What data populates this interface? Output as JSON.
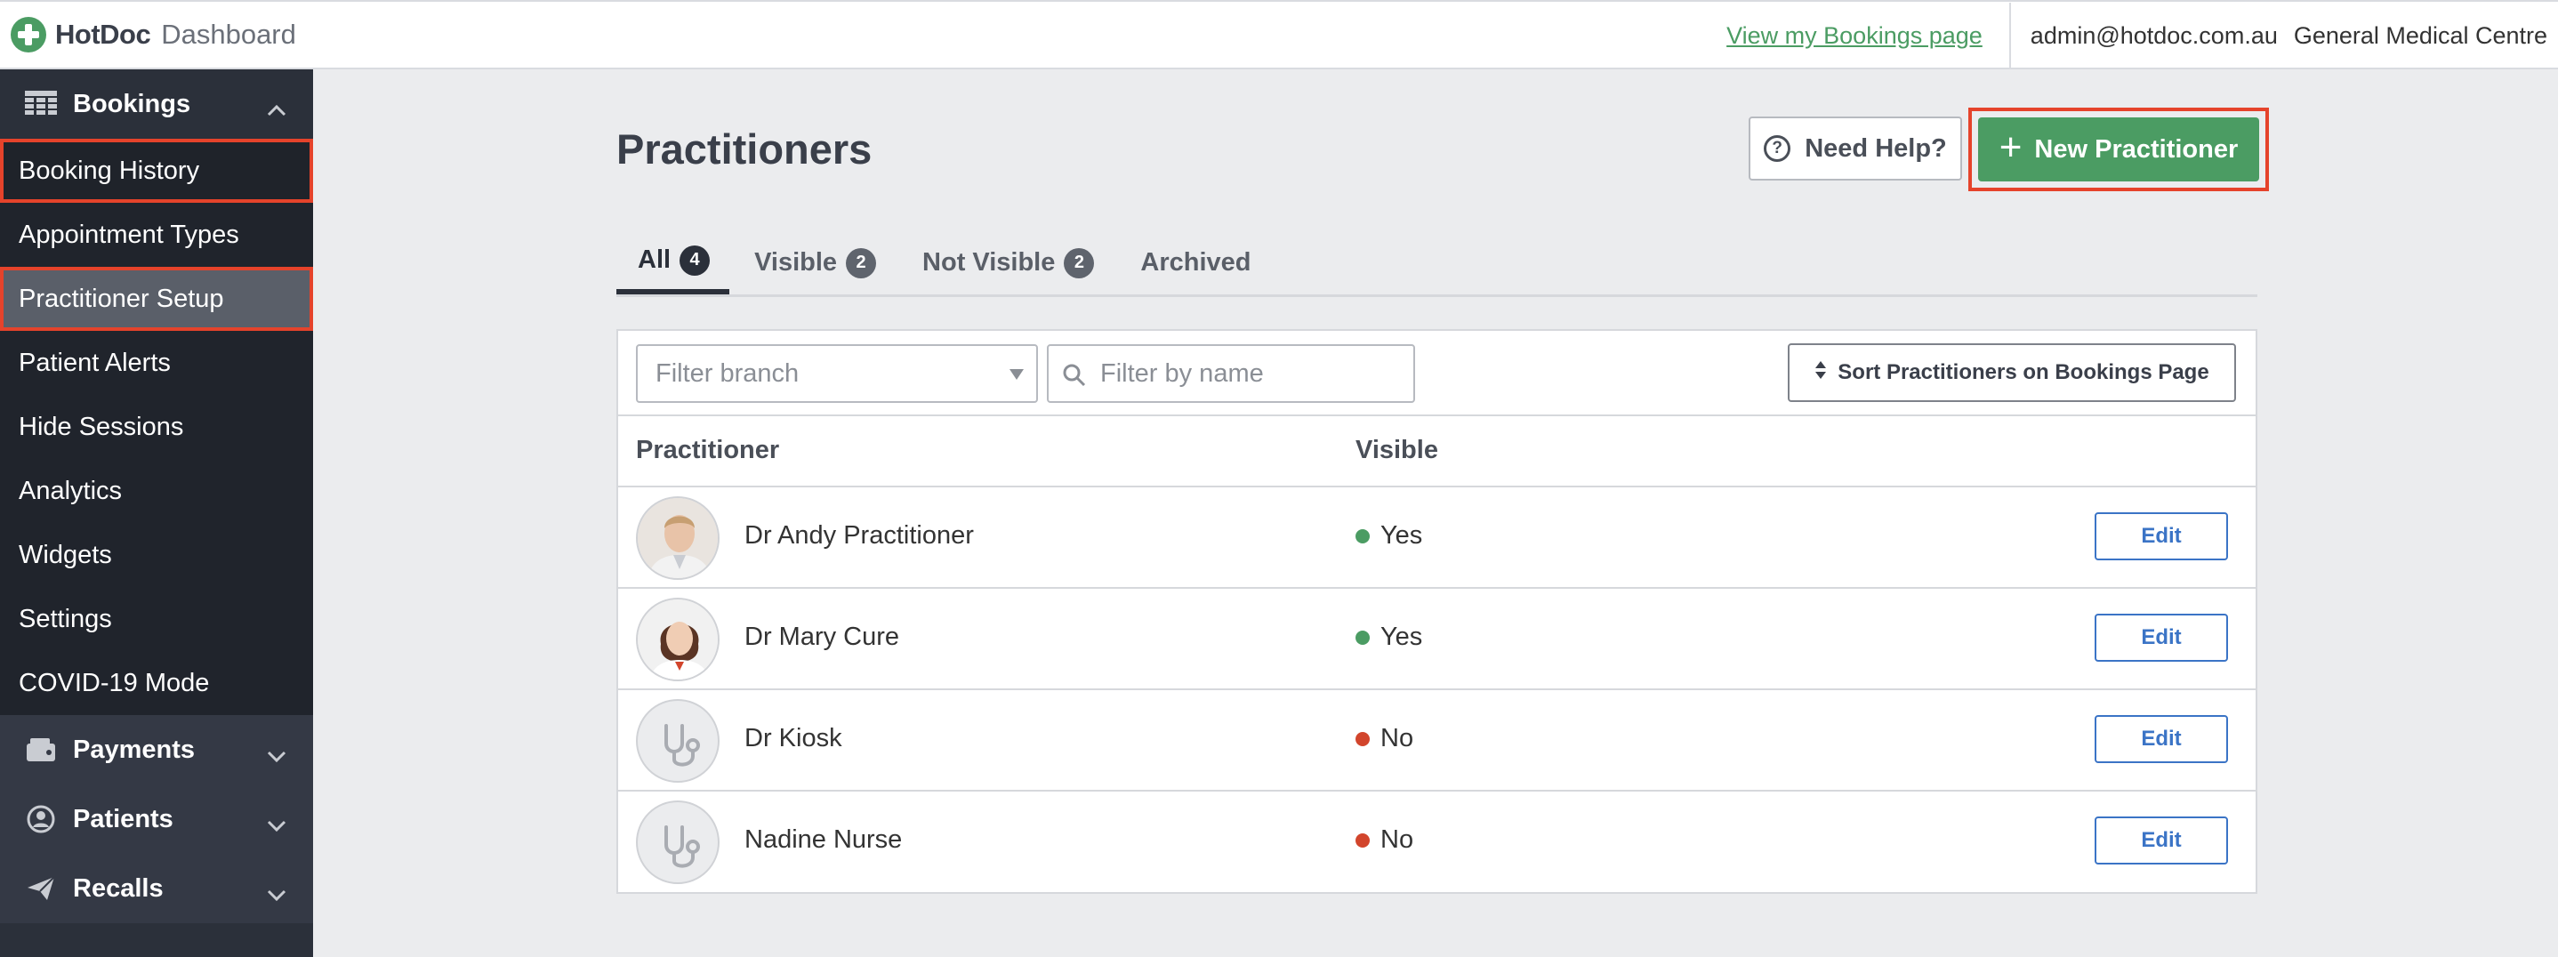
{
  "header": {
    "brand_name": "HotDoc",
    "brand_sub": "Dashboard",
    "view_bookings_link": "View my Bookings page",
    "user_email": "admin@hotdoc.com.au",
    "clinic_name": "General Medical Centre"
  },
  "sidebar": {
    "bookings": {
      "label": "Bookings",
      "icon": "table-grid-icon",
      "expanded": true,
      "items": [
        {
          "label": "Booking History",
          "highlighted": true
        },
        {
          "label": "Appointment Types"
        },
        {
          "label": "Practitioner Setup",
          "active": true,
          "highlighted": true
        },
        {
          "label": "Patient Alerts"
        },
        {
          "label": "Hide Sessions"
        },
        {
          "label": "Analytics"
        },
        {
          "label": "Widgets"
        },
        {
          "label": "Settings"
        },
        {
          "label": "COVID-19 Mode"
        }
      ]
    },
    "payments": {
      "label": "Payments",
      "icon": "wallet-icon"
    },
    "patients": {
      "label": "Patients",
      "icon": "user-circle-icon"
    },
    "recalls": {
      "label": "Recalls",
      "icon": "paper-plane-icon"
    }
  },
  "main": {
    "title": "Practitioners",
    "help_button": "Need Help?",
    "new_button": "New Practitioner",
    "tabs": [
      {
        "label": "All",
        "count": "4",
        "active": true
      },
      {
        "label": "Visible",
        "count": "2"
      },
      {
        "label": "Not Visible",
        "count": "2"
      },
      {
        "label": "Archived"
      }
    ],
    "filters": {
      "branch_placeholder": "Filter branch",
      "name_placeholder": "Filter by name",
      "sort_button": "Sort Practitioners on Bookings Page"
    },
    "table": {
      "columns": [
        "Practitioner",
        "Visible"
      ],
      "rows": [
        {
          "name": "Dr Andy Practitioner",
          "visible": "Yes",
          "avatar": "male-photo",
          "edit": "Edit"
        },
        {
          "name": "Dr Mary Cure",
          "visible": "Yes",
          "avatar": "female-photo",
          "edit": "Edit"
        },
        {
          "name": "Dr Kiosk",
          "visible": "No",
          "avatar": "stethoscope-icon",
          "edit": "Edit"
        },
        {
          "name": "Nadine Nurse",
          "visible": "No",
          "avatar": "stethoscope-icon",
          "edit": "Edit"
        }
      ]
    }
  },
  "colors": {
    "brand_green": "#4b9c63",
    "sidebar_bg": "#2b303a",
    "highlight_red": "#e5432b",
    "link_blue": "#3b74c6",
    "status_no": "#d2452c"
  }
}
